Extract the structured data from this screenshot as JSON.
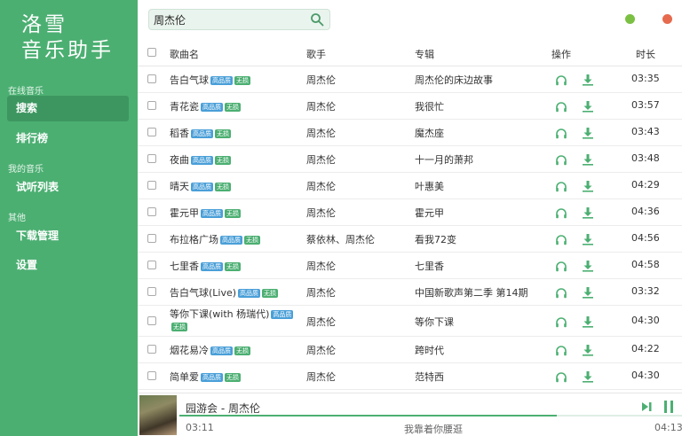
{
  "app": {
    "logo_line1": "洛雪",
    "logo_line2": "音乐助手"
  },
  "sidebar": {
    "sections": [
      {
        "title": "在线音乐",
        "items": [
          {
            "label": "搜索",
            "active": true
          },
          {
            "label": "排行榜",
            "active": false
          }
        ]
      },
      {
        "title": "我的音乐",
        "items": [
          {
            "label": "试听列表",
            "active": false
          }
        ]
      },
      {
        "title": "其他",
        "items": [
          {
            "label": "下载管理",
            "active": false
          },
          {
            "label": "设置",
            "active": false
          }
        ]
      }
    ]
  },
  "search": {
    "value": "周杰伦",
    "icon": "search-icon"
  },
  "window_controls": {
    "minimize_color": "#7bc043",
    "close_color": "#e66b4e"
  },
  "table": {
    "headers": {
      "name": "歌曲名",
      "artist": "歌手",
      "album": "专辑",
      "actions": "操作",
      "duration": "时长"
    },
    "badges": {
      "hq": "高品质",
      "lossless": "无损"
    },
    "rows": [
      {
        "name": "告白气球",
        "artist": "周杰伦",
        "album": "周杰伦的床边故事",
        "duration": "03:35",
        "wrap": false
      },
      {
        "name": "青花瓷",
        "artist": "周杰伦",
        "album": "我很忙",
        "duration": "03:57",
        "wrap": false
      },
      {
        "name": "稻香",
        "artist": "周杰伦",
        "album": "魔杰座",
        "duration": "03:43",
        "wrap": false
      },
      {
        "name": "夜曲",
        "artist": "周杰伦",
        "album": "十一月的萧邦",
        "duration": "03:48",
        "wrap": false
      },
      {
        "name": "晴天",
        "artist": "周杰伦",
        "album": "叶惠美",
        "duration": "04:29",
        "wrap": false
      },
      {
        "name": "霍元甲",
        "artist": "周杰伦",
        "album": "霍元甲",
        "duration": "04:36",
        "wrap": false
      },
      {
        "name": "布拉格广场",
        "artist": "蔡依林、周杰伦",
        "album": "看我72变",
        "duration": "04:56",
        "wrap": false
      },
      {
        "name": "七里香",
        "artist": "周杰伦",
        "album": "七里香",
        "duration": "04:58",
        "wrap": false
      },
      {
        "name": "告白气球(Live)",
        "artist": "周杰伦",
        "album": "中国新歌声第二季 第14期",
        "duration": "03:32",
        "wrap": false
      },
      {
        "name": "等你下课(with 杨瑞代)",
        "artist": "周杰伦",
        "album": "等你下课",
        "duration": "04:30",
        "wrap": true
      },
      {
        "name": "烟花易冷",
        "artist": "周杰伦",
        "album": "跨时代",
        "duration": "04:22",
        "wrap": false
      },
      {
        "name": "简单爱",
        "artist": "周杰伦",
        "album": "范特西",
        "duration": "04:30",
        "wrap": false
      }
    ]
  },
  "player": {
    "title": "园游会 - 周杰伦",
    "current_time": "03:11",
    "total_time": "04:13",
    "lyric": "我靠着你腰逛",
    "progress": 0.75,
    "accent": "#4caf72"
  }
}
